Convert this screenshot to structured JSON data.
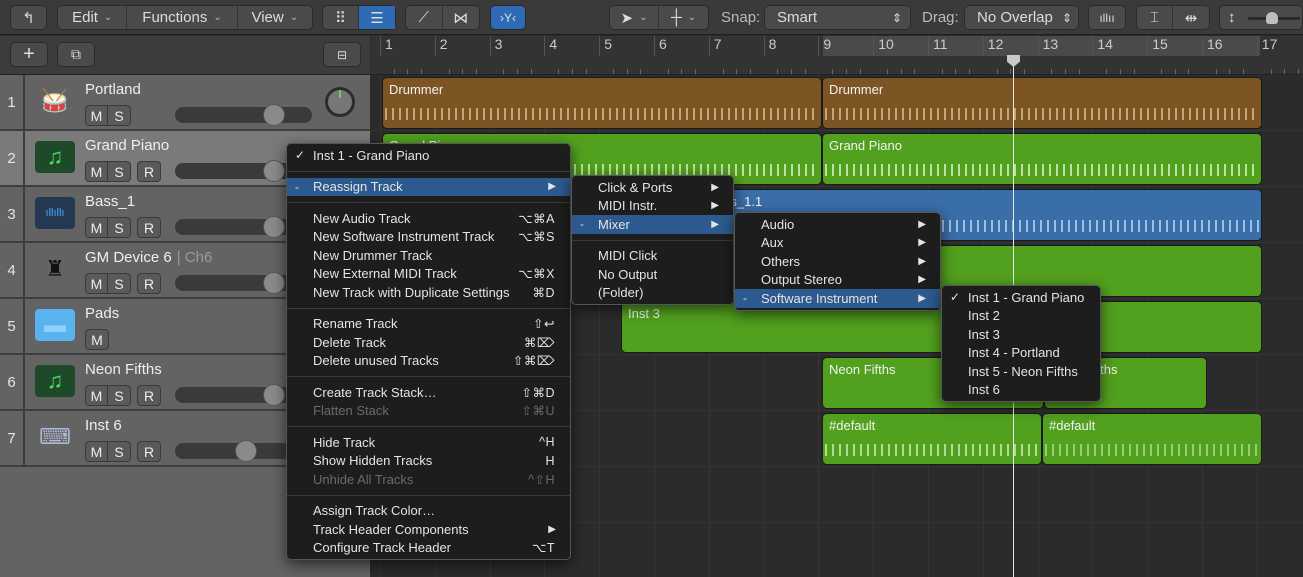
{
  "toolbar": {
    "back_icon": "back-arrow-icon",
    "edit": "Edit",
    "functions": "Functions",
    "view": "View",
    "snap_label": "Snap:",
    "snap_value": "Smart",
    "drag_label": "Drag:",
    "drag_value": "No Overlap",
    "chev": "⌄",
    "updown": "⇕"
  },
  "ruler": {
    "bars": [
      "1",
      "2",
      "3",
      "4",
      "5",
      "6",
      "7",
      "8",
      "9",
      "10",
      "11",
      "12",
      "13",
      "14",
      "15",
      "16",
      "17"
    ]
  },
  "tracks": [
    {
      "num": "1",
      "name": "Portland",
      "channel": "",
      "buttons": [
        "M",
        "S"
      ],
      "icon": "drummer-kit-icon",
      "volume": 0.72,
      "selected": false
    },
    {
      "num": "2",
      "name": "Grand Piano",
      "channel": "",
      "buttons": [
        "M",
        "S",
        "R"
      ],
      "icon": "music-note-icon",
      "volume": 0.72,
      "selected": true
    },
    {
      "num": "3",
      "name": "Bass_1",
      "channel": "",
      "buttons": [
        "M",
        "S",
        "R"
      ],
      "icon": "audio-waveform-icon",
      "volume": 0.72,
      "selected": false
    },
    {
      "num": "4",
      "name": "GM Device 6",
      "channel": "| Ch6",
      "buttons": [
        "M",
        "S",
        "R"
      ],
      "icon": "grand-piano-icon",
      "volume": 0.72,
      "selected": false
    },
    {
      "num": "5",
      "name": "Pads",
      "channel": "",
      "buttons": [
        "M"
      ],
      "icon": "folder-icon",
      "volume": null,
      "selected": false
    },
    {
      "num": "6",
      "name": "Neon Fifths",
      "channel": "",
      "buttons": [
        "M",
        "S",
        "R"
      ],
      "icon": "music-note-icon",
      "volume": 0.72,
      "selected": false
    },
    {
      "num": "7",
      "name": "Inst 6",
      "channel": "",
      "buttons": [
        "M",
        "S",
        "R"
      ],
      "icon": "keyboard-stand-icon",
      "volume": 0.52,
      "selected": false
    }
  ],
  "regions": {
    "drummer1": "Drummer",
    "drummer2": "Drummer",
    "piano1": "Grand Piano",
    "piano2": "Grand Piano",
    "bass": "Bass_1.1",
    "inst3": "Inst 3",
    "neon1": "Neon Fifths",
    "neon2": "Neon Fifths",
    "default": "#default"
  },
  "context_menu": {
    "current": "Inst 1 - Grand Piano",
    "reassign": "Reassign Track",
    "items_new": [
      {
        "label": "New Audio Track",
        "shortcut": "⌥⌘A"
      },
      {
        "label": "New Software Instrument Track",
        "shortcut": "⌥⌘S"
      },
      {
        "label": "New Drummer Track",
        "shortcut": ""
      },
      {
        "label": "New External MIDI Track",
        "shortcut": "⌥⌘X"
      },
      {
        "label": "New Track with Duplicate Settings",
        "shortcut": "⌘D"
      }
    ],
    "items_edit": [
      {
        "label": "Rename Track",
        "shortcut": "⇧↩"
      },
      {
        "label": "Delete Track",
        "shortcut": "⌘⌦"
      },
      {
        "label": "Delete unused Tracks",
        "shortcut": "⇧⌘⌦"
      }
    ],
    "items_stack": [
      {
        "label": "Create Track Stack…",
        "shortcut": "⇧⌘D",
        "disabled": false
      },
      {
        "label": "Flatten Stack",
        "shortcut": "⇧⌘U",
        "disabled": true
      }
    ],
    "items_hide": [
      {
        "label": "Hide Track",
        "shortcut": "^H",
        "disabled": false
      },
      {
        "label": "Show Hidden Tracks",
        "shortcut": "H",
        "disabled": false
      },
      {
        "label": "Unhide All Tracks",
        "shortcut": "^⇧H",
        "disabled": true
      }
    ],
    "items_config": [
      {
        "label": "Assign Track Color…",
        "shortcut": ""
      },
      {
        "label": "Track Header Components",
        "shortcut": ""
      },
      {
        "label": "Configure Track Header",
        "shortcut": "⌥T"
      }
    ]
  },
  "reassign_menu": {
    "items": [
      "Click & Ports",
      "MIDI Instr.",
      "Mixer"
    ],
    "items2": [
      "MIDI Click",
      "No Output",
      "(Folder)"
    ]
  },
  "mixer_menu": {
    "items": [
      "Audio",
      "Aux",
      "Others",
      "Output Stereo",
      "Software Instrument"
    ]
  },
  "instrument_menu": {
    "items": [
      "Inst 1 - Grand Piano",
      "Inst 2",
      "Inst 3",
      "Inst 4 - Portland",
      "Inst 5 - Neon Fifths",
      "Inst 6"
    ],
    "checked": 0
  },
  "glyphs": {
    "check": "✓",
    "dash": "-",
    "arrow": "▶"
  },
  "colors": {
    "accent": "#2f6bb5",
    "drummer": "#7d5424",
    "midi": "#52a11e",
    "audio": "#3a6ea8",
    "menu_highlight": "#2c5a8e"
  }
}
